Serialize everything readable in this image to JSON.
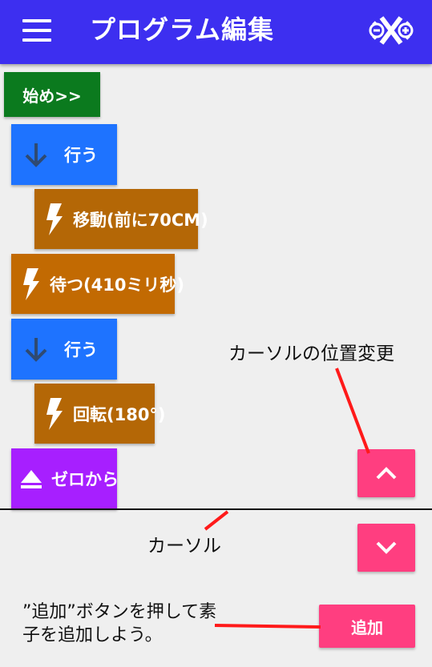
{
  "appbar": {
    "title": "プログラム編集",
    "menu_icon": "hamburger-menu-icon",
    "controller_icon": "gamepad-icon",
    "color": "#3d2ff0"
  },
  "program": {
    "start_label": "始め>>",
    "blocks": [
      {
        "label": "行う",
        "icon": "arrow-down-icon",
        "color": "#1e73ff"
      },
      {
        "label": "移動(前に70CM)",
        "icon": "lightning-icon",
        "color": "#b46706"
      },
      {
        "label": "待つ(410ミリ秒)",
        "icon": "lightning-icon",
        "color": "#c26a02"
      },
      {
        "label": "行う",
        "icon": "arrow-down-icon",
        "color": "#1e73ff"
      },
      {
        "label": "回転(180°)",
        "icon": "lightning-icon",
        "color": "#b46706"
      },
      {
        "label": "ゼロから",
        "icon": "eject-icon",
        "color": "#a71fff"
      }
    ]
  },
  "controls": {
    "up_icon": "chevron-up-icon",
    "down_icon": "chevron-down-icon",
    "add_label": "追加",
    "accent": "#ff3e80"
  },
  "annotations": {
    "cursor_move": "カーソルの位置変更",
    "cursor": "カーソル",
    "add_hint": "”追加”ボタンを押して素子を追加しよう。",
    "arrow_color": "#ff1a1a"
  }
}
